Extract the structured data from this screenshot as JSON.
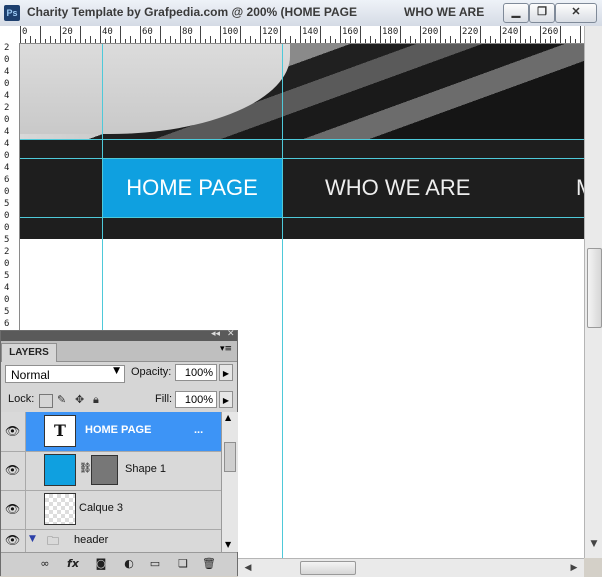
{
  "window": {
    "app_icon": "Ps",
    "title": "Charity Template by Grafpedia.com @ 200% (HOME PAGE",
    "title_right": "WHO WE ARE",
    "buttons": [
      "minimize-icon",
      "restore-icon",
      "close-icon"
    ]
  },
  "ruler": {
    "top_labels": [
      "0",
      "20",
      "40",
      "60",
      "80",
      "100",
      "120",
      "140",
      "160",
      "180",
      "200",
      "220",
      "240",
      "260"
    ],
    "left_labels": [
      "2",
      "0",
      "4",
      "0",
      "4",
      "2",
      "0",
      "4",
      "4",
      "0",
      "4",
      "6",
      "0",
      "5",
      "0",
      "0",
      "5",
      "2",
      "0",
      "5",
      "4",
      "0",
      "5",
      "6"
    ]
  },
  "canvas": {
    "nav_items": [
      "HOME PAGE",
      "WHO WE ARE",
      "M"
    ],
    "active_color": "#0fa0e0",
    "guide_color": "#4ec9d9"
  },
  "layers_panel": {
    "tab": "LAYERS",
    "blend_mode": "Normal",
    "opacity_label": "Opacity:",
    "opacity_value": "100%",
    "lock_label": "Lock:",
    "fill_label": "Fill:",
    "fill_value": "100%",
    "layers": [
      {
        "name": "HOME PAGE",
        "suffix": "...",
        "type": "text",
        "selected": true,
        "thumb_text": "T"
      },
      {
        "name": "Shape 1",
        "type": "shape",
        "selected": false
      },
      {
        "name": "Calque 3",
        "type": "raster",
        "selected": false
      },
      {
        "name": "header",
        "type": "group",
        "selected": false
      }
    ],
    "bottom_icons": [
      "link-layers-icon",
      "fx-icon",
      "add-mask-icon",
      "adjustment-layer-icon",
      "new-group-icon",
      "new-layer-icon",
      "trash-icon"
    ],
    "fx_label": "fx"
  }
}
